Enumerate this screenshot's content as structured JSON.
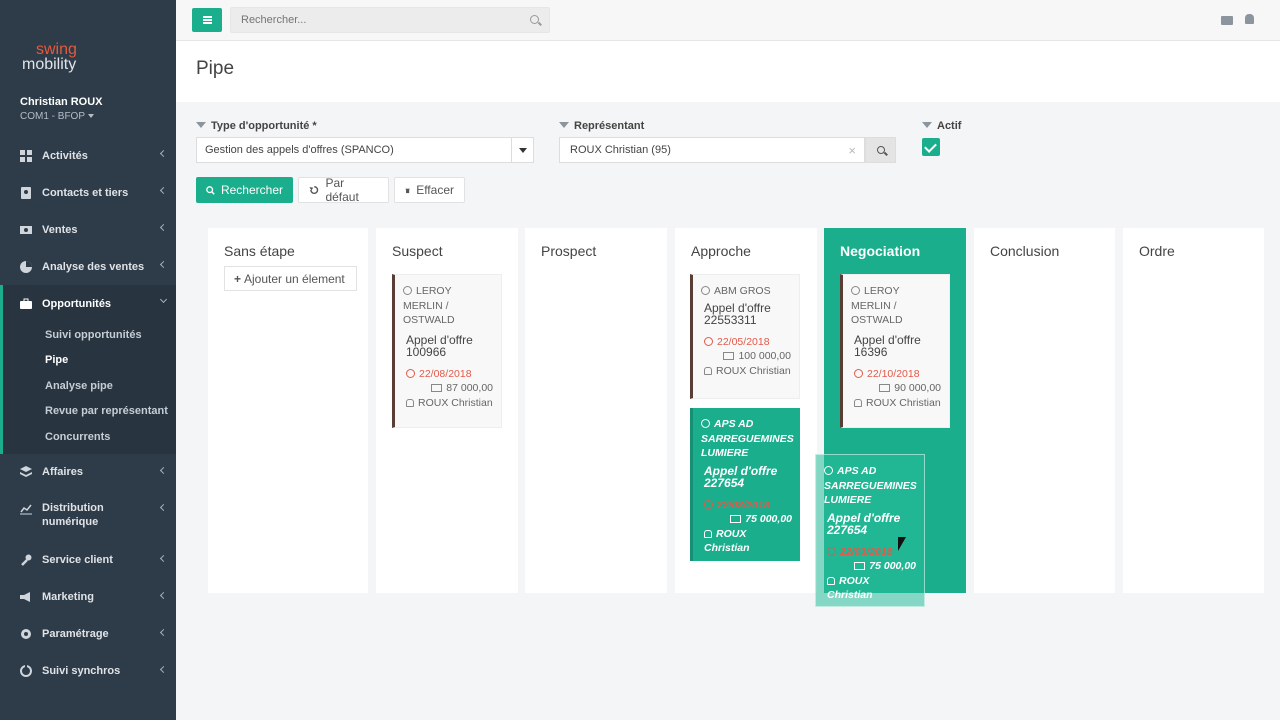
{
  "brand": {
    "line1": "swing",
    "line2": "mobility"
  },
  "user": {
    "name": "Christian ROUX",
    "role": "COM1 - BFOP"
  },
  "nav": [
    {
      "label": "Activités",
      "icon": "dashboard-icon"
    },
    {
      "label": "Contacts et tiers",
      "icon": "address-book-icon"
    },
    {
      "label": "Ventes",
      "icon": "money-icon"
    },
    {
      "label": "Analyse des ventes",
      "icon": "pie-chart-icon"
    },
    {
      "label": "Opportunités",
      "icon": "briefcase-icon"
    },
    {
      "label": "Affaires",
      "icon": "layers-icon"
    },
    {
      "label": "Distribution numérique",
      "icon": "line-chart-icon"
    },
    {
      "label": "Service client",
      "icon": "wrench-icon"
    },
    {
      "label": "Marketing",
      "icon": "bullhorn-icon"
    },
    {
      "label": "Paramétrage",
      "icon": "gear-icon"
    },
    {
      "label": "Suivi synchros",
      "icon": "sync-icon"
    }
  ],
  "subnav": [
    "Suivi opportunités",
    "Pipe",
    "Analyse pipe",
    "Revue par représentant",
    "Concurrents"
  ],
  "topbar": {
    "search_placeholder": "Rechercher..."
  },
  "page": {
    "title": "Pipe"
  },
  "filters": {
    "type_label": "Type d'opportunité *",
    "type_value": "Gestion des appels d'offres (SPANCO)",
    "rep_label": "Représentant",
    "rep_value": "ROUX Christian (95)",
    "active_label": "Actif",
    "active_checked": true
  },
  "buttons": {
    "search": "Rechercher",
    "default": "Par défaut",
    "clear": "Effacer"
  },
  "columns": [
    "Sans étape",
    "Suspect",
    "Prospect",
    "Approche",
    "Negociation",
    "Conclusion",
    "Ordre"
  ],
  "add_element": "Ajouter un élement",
  "cards": {
    "suspect_1": {
      "company": "LEROY MERLIN / OSTWALD",
      "title": "Appel d'offre 100966",
      "date": "22/08/2018",
      "amount": "87 000,00",
      "rep": "ROUX Christian"
    },
    "approche_1": {
      "company": "ABM GROS",
      "title": "Appel d'offre 22553311",
      "date": "22/05/2018",
      "amount": "100 000,00",
      "rep": "ROUX Christian"
    },
    "approche_2": {
      "company": "APS AD SARREGUEMINES LUMIERE",
      "title": "Appel d'offre 227654",
      "date": "22/03/2018",
      "amount": "75 000,00",
      "rep": "ROUX Christian"
    },
    "nego_1": {
      "company": "LEROY MERLIN / OSTWALD",
      "title": "Appel d'offre 16396",
      "date": "22/10/2018",
      "amount": "90 000,00",
      "rep": "ROUX Christian"
    },
    "drag": {
      "company": "APS AD SARREGUEMINES LUMIERE",
      "title": "Appel d'offre 227654",
      "date": "22/03/2018",
      "amount": "75 000,00",
      "rep": "ROUX Christian"
    }
  }
}
